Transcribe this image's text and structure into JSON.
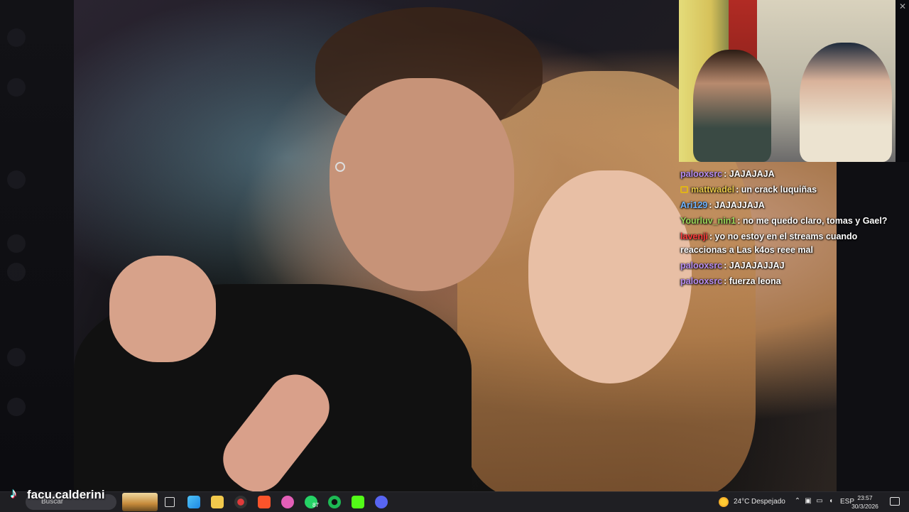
{
  "webcam": {
    "close_label": "✕"
  },
  "chat": {
    "messages": [
      {
        "user": "paloox​src",
        "user_color": "#b68cf0",
        "text": ": JAJAJAJA",
        "badge": false
      },
      {
        "user": "mattwadel",
        "user_color": "#e8c84a",
        "text": ": un crack luquiñas",
        "badge": true
      },
      {
        "user": "Ari129",
        "user_color": "#6fb3ff",
        "text": ": JAJAJJAJA",
        "badge": false
      },
      {
        "user": "Yourluv_nin1",
        "user_color": "#9bd65a",
        "text": ": no me quedo claro, tomas y Gael?",
        "badge": false
      },
      {
        "user": "lavenji",
        "user_color": "#ff3a3a",
        "text": ": yo no estoy en el streams cuando reaccionas a Las k4os reee mal",
        "badge": false
      },
      {
        "user": "paloox​src",
        "user_color": "#b68cf0",
        "text": ": JAJAJAJJAJ",
        "badge": false
      },
      {
        "user": "paloox​src",
        "user_color": "#b68cf0",
        "text": ": fuerza leona",
        "badge": false
      }
    ]
  },
  "watermark": {
    "handle": "facu.calderini"
  },
  "taskbar": {
    "search_placeholder": "Buscar",
    "whatsapp_badge": "87",
    "weather_temp": "24°C",
    "weather_desc": "Despejado",
    "lang": "ESP",
    "time": "23:57",
    "date": "30/3/2026"
  }
}
